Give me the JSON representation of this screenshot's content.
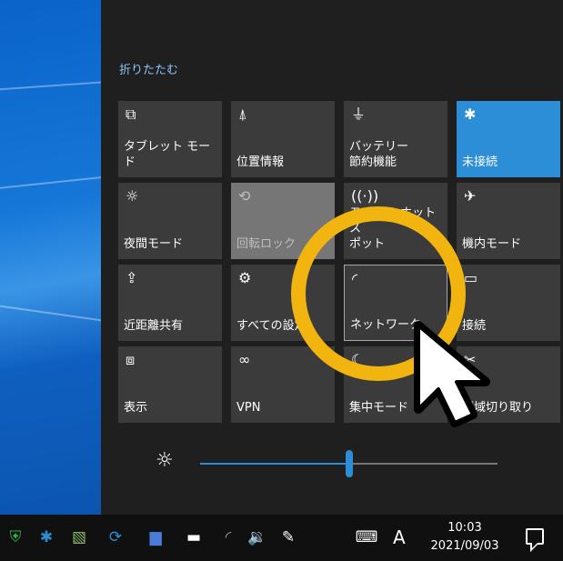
{
  "action_center": {
    "collapse_label": "折りたたむ",
    "tiles": [
      {
        "label": "タブレット モード",
        "icon": "tablet-mode-icon",
        "glyph": "⧉",
        "state": "off"
      },
      {
        "label": "位置情報",
        "icon": "location-icon",
        "glyph": "⍋",
        "state": "off"
      },
      {
        "label": "バッテリー\n節約機能",
        "icon": "battery-saver-icon",
        "glyph": "⏚",
        "state": "off"
      },
      {
        "label": "未接続",
        "icon": "bluetooth-icon",
        "glyph": "✱",
        "state": "on"
      },
      {
        "label": "夜間モード",
        "icon": "night-light-icon",
        "glyph": "☼",
        "state": "off"
      },
      {
        "label": "回転ロック",
        "icon": "rotation-lock-icon",
        "glyph": "⟲",
        "state": "disabled"
      },
      {
        "label": "モバイル ホットス\nポット",
        "icon": "mobile-hotspot-icon",
        "glyph": "((·))",
        "state": "off"
      },
      {
        "label": "機内モード",
        "icon": "airplane-mode-icon",
        "glyph": "✈",
        "state": "off"
      },
      {
        "label": "近距離共有",
        "icon": "nearby-sharing-icon",
        "glyph": "⇪",
        "state": "off"
      },
      {
        "label": "すべての設定",
        "icon": "settings-gear-icon",
        "glyph": "⚙",
        "state": "off"
      },
      {
        "label": "ネットワーク",
        "icon": "network-icon",
        "glyph": "◜",
        "state": "selected"
      },
      {
        "label": "接続",
        "icon": "connect-icon",
        "glyph": "▭",
        "state": "off"
      },
      {
        "label": "表示",
        "icon": "project-icon",
        "glyph": "⧈",
        "state": "off"
      },
      {
        "label": "VPN",
        "icon": "vpn-icon",
        "glyph": "∞",
        "state": "off"
      },
      {
        "label": "集中モード",
        "icon": "focus-assist-icon",
        "glyph": "☾",
        "state": "off"
      },
      {
        "label": "領域切り取り",
        "icon": "snip-icon",
        "glyph": "✂",
        "state": "off"
      }
    ],
    "brightness": {
      "icon": "brightness-sun-icon",
      "level": 0.5
    }
  },
  "taskbar": {
    "icons": [
      {
        "name": "defender-icon",
        "glyph": "⛨",
        "color": "#2db34a"
      },
      {
        "name": "bluetooth-tray-icon",
        "glyph": "✱",
        "color": "#2c8ed6"
      },
      {
        "name": "network-tray-icon",
        "glyph": "▧",
        "color": "#8fbf6a"
      },
      {
        "name": "sync-icon",
        "glyph": "⟳",
        "color": "#2c8ed6"
      },
      {
        "name": "display-icon",
        "glyph": "▆",
        "color": "#4a7bd8"
      },
      {
        "name": "battery-icon",
        "glyph": "▬",
        "color": "#ffffff"
      },
      {
        "name": "wifi-icon",
        "glyph": "◜",
        "color": "#9a9a9a"
      },
      {
        "name": "volume-icon",
        "glyph": "🔉",
        "color": "#ffffff"
      },
      {
        "name": "pen-icon",
        "glyph": "✎",
        "color": "#ffffff"
      },
      {
        "name": "keyboard-icon",
        "glyph": "⌨",
        "color": "#ffffff"
      }
    ],
    "ime_label": "A",
    "time": "10:03",
    "date": "2021/09/03",
    "notification_icon": "notification-center-icon"
  },
  "colors": {
    "accent": "#2c8ed6",
    "highlight_ring": "#f2b50f"
  }
}
